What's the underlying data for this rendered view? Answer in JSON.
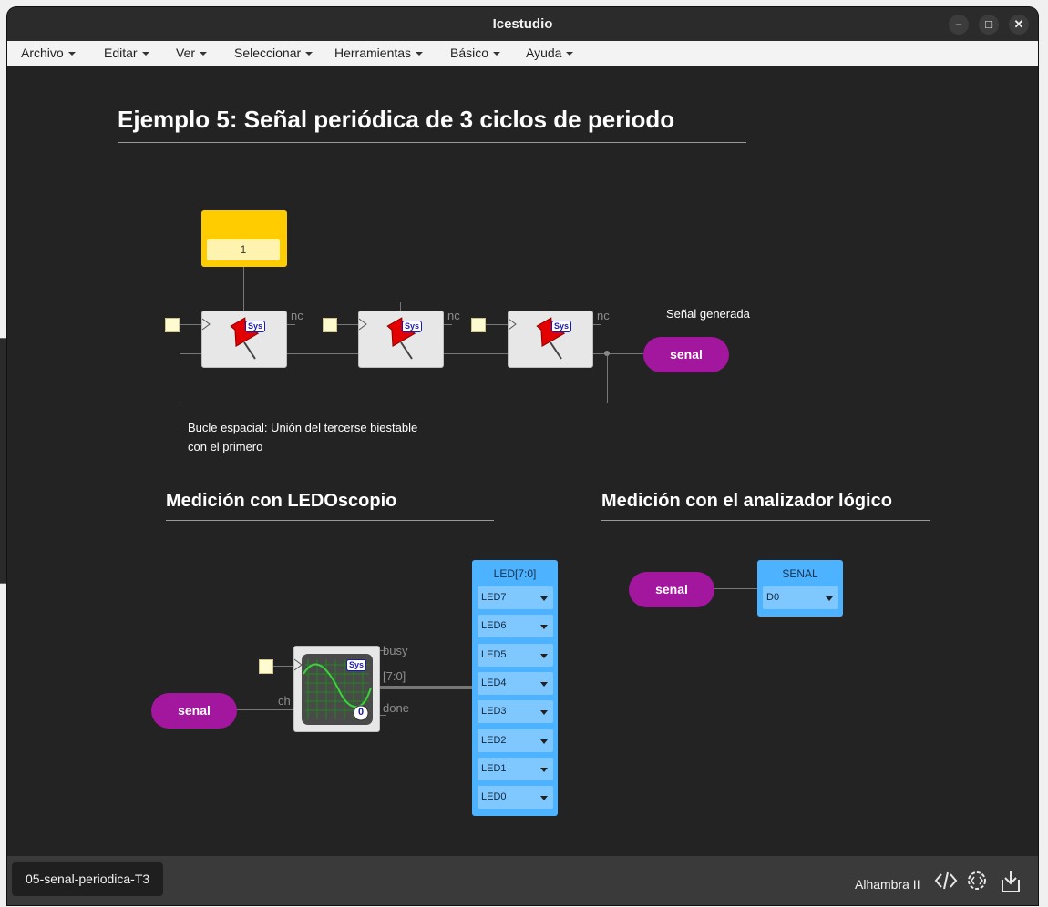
{
  "window": {
    "title": "Icestudio",
    "controls": {
      "minimize": "–",
      "maximize": "□",
      "close": "✕"
    }
  },
  "menu": [
    "Archivo",
    "Editar",
    "Ver",
    "Seleccionar",
    "Herramientas",
    "Básico",
    "Ayuda"
  ],
  "canvas": {
    "title": "Ejemplo 5: Señal periódica de 3 ciclos de periodo",
    "constant_value": "1",
    "nc_label": "nc",
    "signal_note": "Señal generada",
    "loop_note_line1": "Bucle espacial: Unión del tercerse biestable",
    "loop_note_line2": "con el primero",
    "sys_badge": "Sys",
    "senal_label": "senal",
    "ledoscope_heading": "Medición con LEDOscopio",
    "analyzer_heading": "Medición con el analizador lógico",
    "scope_ports": {
      "busy": "busy",
      "bus": "[7:0]",
      "done": "done",
      "ch": "ch",
      "count": "0"
    },
    "led_panel": {
      "title": "LED[7:0]",
      "leds": [
        "LED7",
        "LED6",
        "LED5",
        "LED4",
        "LED3",
        "LED2",
        "LED1",
        "LED0"
      ]
    },
    "senal_panel": {
      "title": "SENAL",
      "value": "D0"
    }
  },
  "status": {
    "file_tab": "05-senal-periodica-T3",
    "board": "Alhambra II",
    "icons": [
      "code-icon",
      "settings-code-icon",
      "download-icon"
    ]
  }
}
